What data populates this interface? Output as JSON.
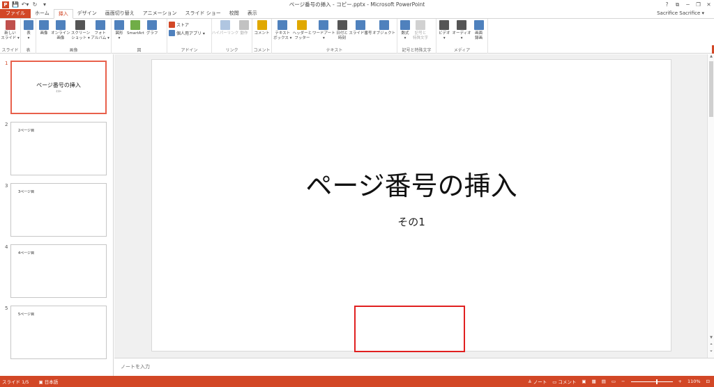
{
  "window": {
    "title": "ページ番号の挿入 - コピー.pptx - Microsoft PowerPoint",
    "user": "Sacrifice Sacrifice ▾",
    "help": "?",
    "restore_ribbon": "⧉",
    "minimize": "─",
    "maximize": "❐",
    "close": "✕"
  },
  "qat": {
    "logo": "P",
    "save": "💾",
    "undo": "↶▾",
    "redo": "↻",
    "customize": "▾"
  },
  "tabs": [
    "ファイル",
    "ホーム",
    "挿入",
    "デザイン",
    "画面切り替え",
    "アニメーション",
    "スライド ショー",
    "校閲",
    "表示"
  ],
  "ribbon": {
    "groups": [
      {
        "label": "スライド",
        "buttons": [
          {
            "label": "新しい\nスライド ▾",
            "color": "#c0504d"
          }
        ]
      },
      {
        "label": "表",
        "buttons": [
          {
            "label": "表\n▾",
            "color": "#4f81bd"
          }
        ]
      },
      {
        "label": "画像",
        "buttons": [
          {
            "label": "画像",
            "color": "#4f81bd"
          },
          {
            "label": "オンライン\n画像",
            "color": "#4f81bd"
          },
          {
            "label": "スクリーン\nショット ▾",
            "color": "#555555"
          },
          {
            "label": "フォト\nアルバム ▾",
            "color": "#4f81bd"
          }
        ]
      },
      {
        "label": "図",
        "buttons": [
          {
            "label": "図形\n▾",
            "color": "#4f81bd"
          },
          {
            "label": "SmartArt",
            "color": "#70ad47"
          },
          {
            "label": "グラフ",
            "color": "#4f81bd"
          }
        ]
      },
      {
        "label": "アドイン",
        "small": [
          {
            "label": "ストア",
            "color": "#d24726"
          },
          {
            "label": "個人用アプリ ▾",
            "color": "#4f81bd"
          }
        ]
      },
      {
        "label": "リンク",
        "buttons": [
          {
            "label": "ハイパーリンク",
            "color": "#4f81bd",
            "disabled": true
          },
          {
            "label": "動作",
            "color": "#777777",
            "disabled": true
          }
        ]
      },
      {
        "label": "コメント",
        "buttons": [
          {
            "label": "コメント",
            "color": "#e0a800"
          }
        ]
      },
      {
        "label": "テキスト",
        "buttons": [
          {
            "label": "テキスト\nボックス ▾",
            "color": "#4f81bd"
          },
          {
            "label": "ヘッダーと\nフッター",
            "color": "#e0a800"
          },
          {
            "label": "ワードアート\n▾",
            "color": "#4f81bd"
          },
          {
            "label": "日付と\n時刻",
            "color": "#555555"
          },
          {
            "label": "スライド番号",
            "color": "#4f81bd"
          },
          {
            "label": "オブジェクト",
            "color": "#4f81bd"
          }
        ]
      },
      {
        "label": "記号と特殊文字",
        "buttons": [
          {
            "label": "数式\n▾",
            "color": "#4f81bd"
          },
          {
            "label": "記号と\n特殊文字",
            "color": "#999999",
            "disabled": true
          }
        ]
      },
      {
        "label": "メディア",
        "buttons": [
          {
            "label": "ビデオ\n▾",
            "color": "#555555"
          },
          {
            "label": "オーディオ\n▾",
            "color": "#555555"
          },
          {
            "label": "画面\n録画",
            "color": "#4f81bd"
          }
        ]
      }
    ]
  },
  "slides": [
    {
      "num": "1",
      "title": "ページ番号の挿入",
      "sub": "その1",
      "selected": true
    },
    {
      "num": "2",
      "body": "2ページ目"
    },
    {
      "num": "3",
      "body": "3ページ目"
    },
    {
      "num": "4",
      "body": "4ページ目"
    },
    {
      "num": "5",
      "body": "5ページ目"
    }
  ],
  "current_slide": {
    "title": "ページ番号の挿入",
    "subtitle": "その1"
  },
  "notes_placeholder": "ノートを入力",
  "status": {
    "slide": "スライド 1/5",
    "language": "日本語",
    "notes": "ノート",
    "comments": "コメント",
    "zoom": "110%",
    "zoom_level_percent": 110
  },
  "colors": {
    "accent": "#d24726",
    "highlight_box": "#e02020",
    "selected_thumb": "#e8604b"
  }
}
